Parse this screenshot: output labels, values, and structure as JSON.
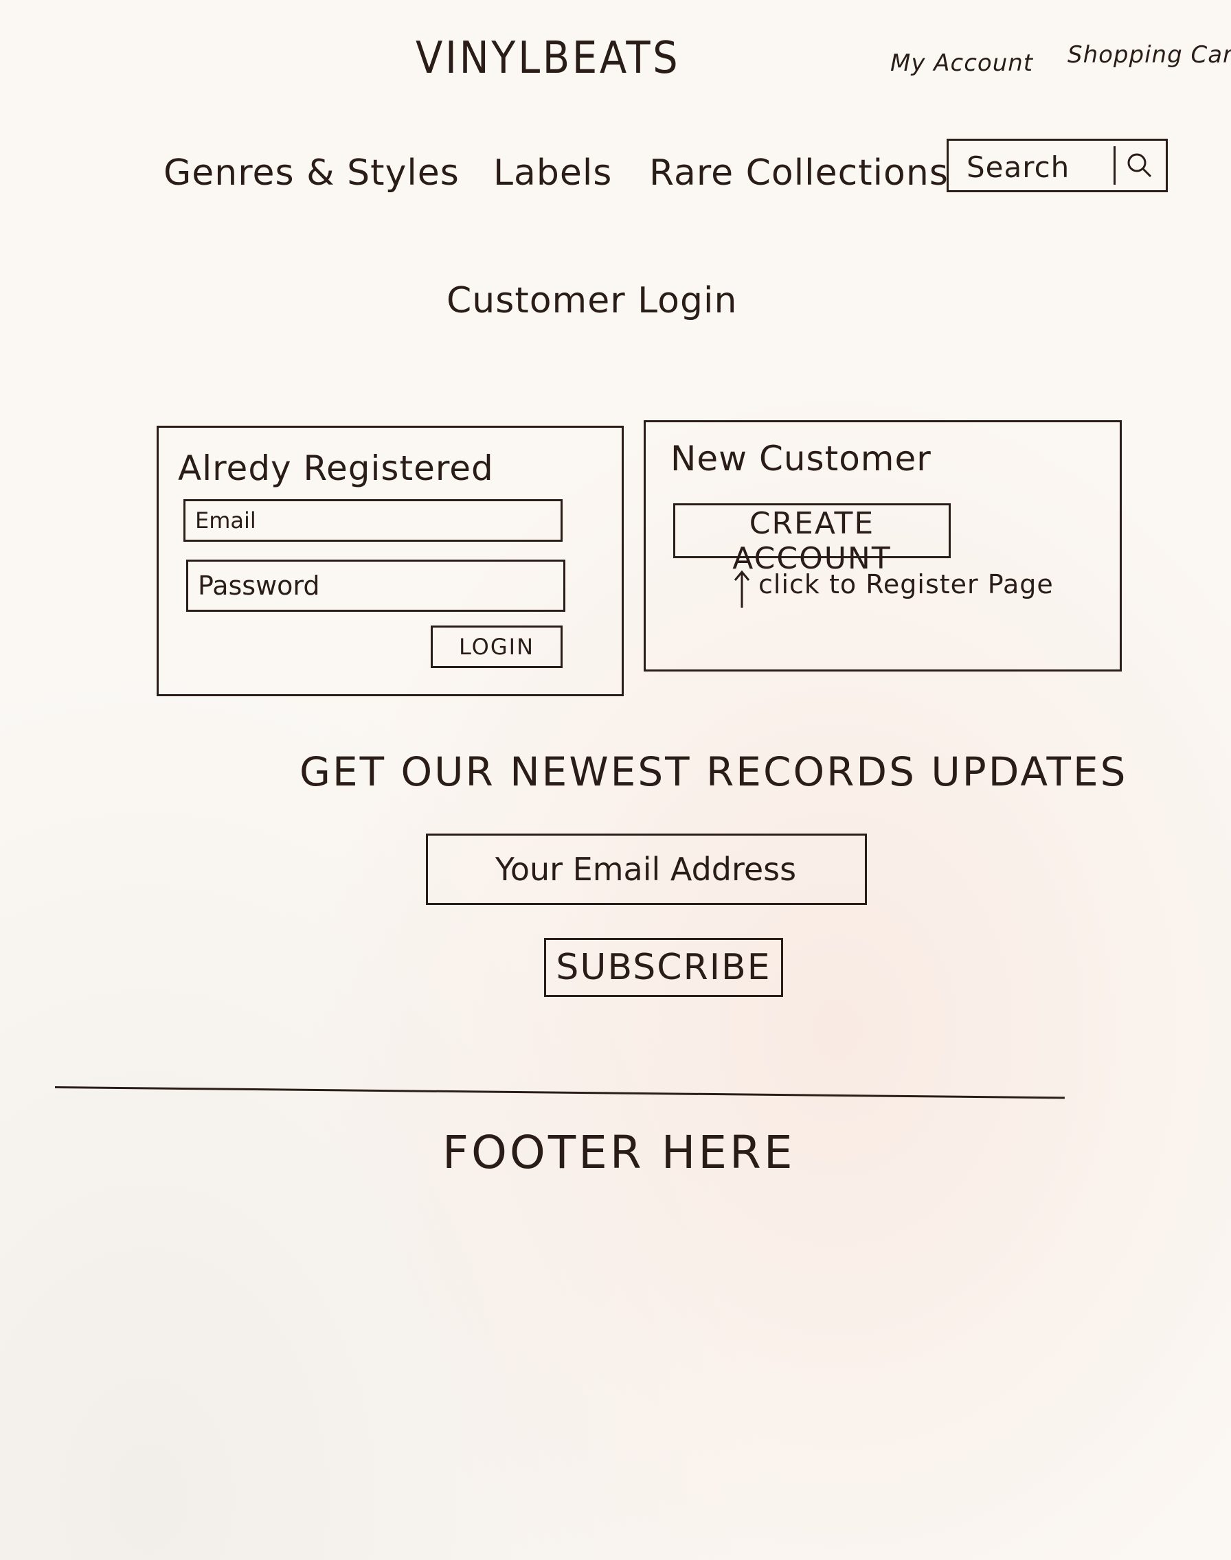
{
  "header": {
    "brand": "VINYLBEATS",
    "account_link": "My Account",
    "cart_link": "Shopping Cart"
  },
  "nav": {
    "items": [
      {
        "label": "Genres & Styles"
      },
      {
        "label": "Labels"
      },
      {
        "label": "Rare Collections"
      }
    ],
    "search": {
      "label": "Search",
      "icon": "search-icon"
    }
  },
  "page": {
    "title": "Customer Login"
  },
  "login_panel": {
    "heading": "Alredy Registered",
    "email_placeholder": "Email",
    "password_placeholder": "Password",
    "login_label": "LOGIN"
  },
  "new_customer_panel": {
    "heading": "New Customer",
    "create_label": "CREATE ACCOUNT",
    "note": "click to Register Page",
    "note_icon": "arrow-up-icon"
  },
  "newsletter": {
    "heading": "GET OUR NEWEST RECORDS UPDATES",
    "input_placeholder": "Your Email Address",
    "subscribe_label": "SUBSCRIBE"
  },
  "footer": {
    "text": "FOOTER HERE"
  },
  "colors": {
    "ink": "#2a1d17",
    "paper": "#fbf8f4"
  }
}
